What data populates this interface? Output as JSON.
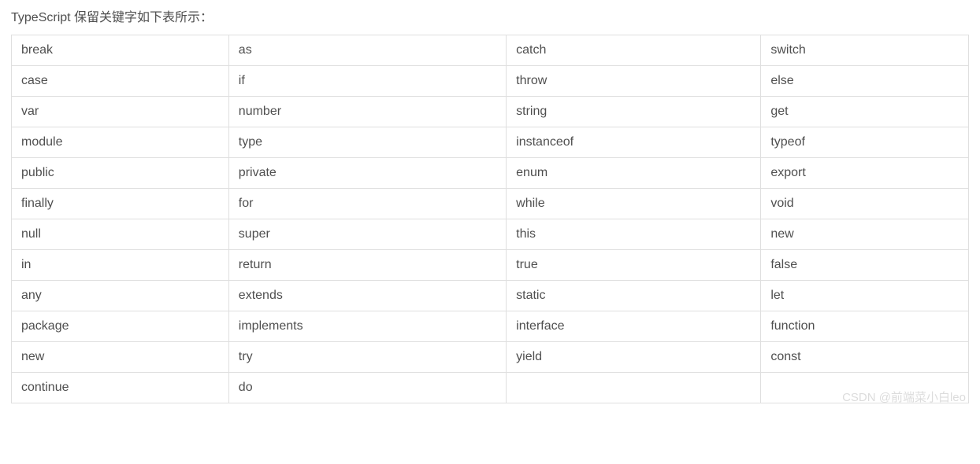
{
  "intro": "TypeScript 保留关键字如下表所示：",
  "table": {
    "rows": [
      [
        "break",
        "as",
        "catch",
        "switch"
      ],
      [
        "case",
        "if",
        "throw",
        "else"
      ],
      [
        "var",
        "number",
        "string",
        "get"
      ],
      [
        "module",
        "type",
        "instanceof",
        "typeof"
      ],
      [
        "public",
        "private",
        "enum",
        "export"
      ],
      [
        "finally",
        "for",
        "while",
        "void"
      ],
      [
        "null",
        "super",
        "this",
        "new"
      ],
      [
        "in",
        "return",
        "true",
        "false"
      ],
      [
        "any",
        "extends",
        "static",
        "let"
      ],
      [
        "package",
        "implements",
        "interface",
        "function"
      ],
      [
        "new",
        "try",
        "yield",
        "const"
      ],
      [
        "continue",
        "do",
        "",
        ""
      ]
    ]
  },
  "watermark": "CSDN @前端菜小白leo"
}
